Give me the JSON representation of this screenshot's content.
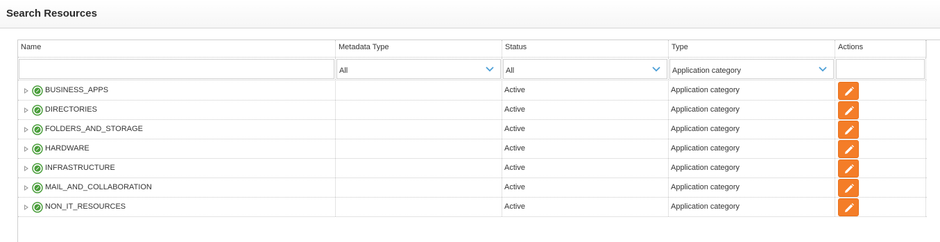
{
  "page": {
    "title": "Search Resources"
  },
  "columns": {
    "name": "Name",
    "metadata_type": "Metadata Type",
    "status": "Status",
    "type": "Type",
    "actions": "Actions"
  },
  "filters": {
    "name_value": "",
    "metadata_type": "All",
    "status": "All",
    "type": "Application category"
  },
  "icons": {
    "expand": "triangle-right-icon",
    "category": "green-circle-resource-icon",
    "edit": "pencil-icon",
    "dropdown": "chevron-down-icon"
  },
  "colors": {
    "accent": "#f47d28",
    "category_icon": "#4a9e3b",
    "chevron": "#4a9ed6"
  },
  "rows": [
    {
      "name": "BUSINESS_APPS",
      "metadata_type": "",
      "status": "Active",
      "type": "Application category"
    },
    {
      "name": "DIRECTORIES",
      "metadata_type": "",
      "status": "Active",
      "type": "Application category"
    },
    {
      "name": "FOLDERS_AND_STORAGE",
      "metadata_type": "",
      "status": "Active",
      "type": "Application category"
    },
    {
      "name": "HARDWARE",
      "metadata_type": "",
      "status": "Active",
      "type": "Application category"
    },
    {
      "name": "INFRASTRUCTURE",
      "metadata_type": "",
      "status": "Active",
      "type": "Application category"
    },
    {
      "name": "MAIL_AND_COLLABORATION",
      "metadata_type": "",
      "status": "Active",
      "type": "Application category"
    },
    {
      "name": "NON_IT_RESOURCES",
      "metadata_type": "",
      "status": "Active",
      "type": "Application category"
    }
  ]
}
